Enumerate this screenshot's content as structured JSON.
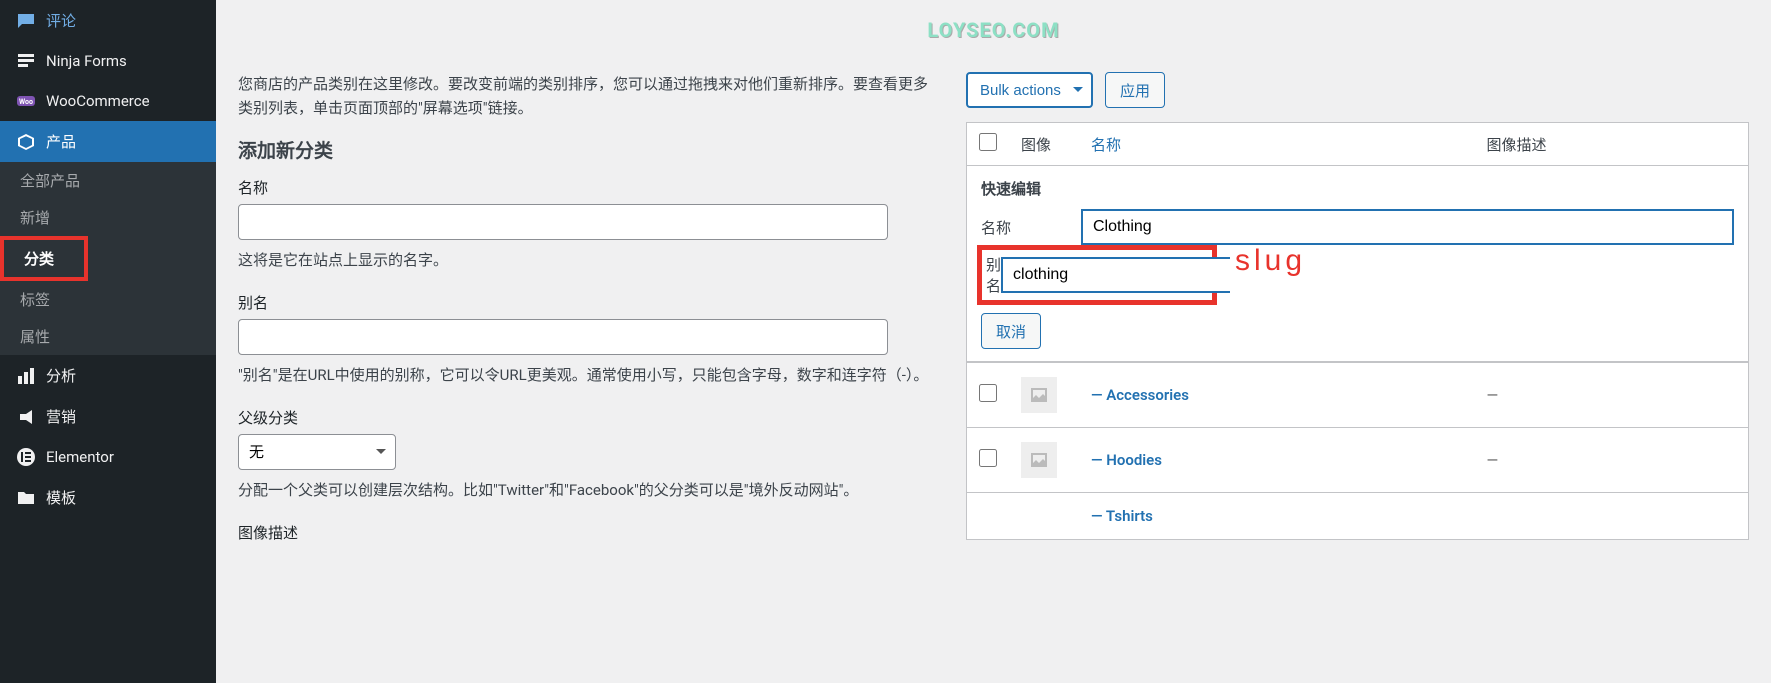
{
  "watermark": "LOYSEO.COM",
  "sidebar": {
    "items": [
      {
        "label": "评论",
        "icon": "comment"
      },
      {
        "label": "Ninja Forms",
        "icon": "form"
      },
      {
        "label": "WooCommerce",
        "icon": "woo"
      },
      {
        "label": "产品",
        "icon": "product",
        "active": true
      },
      {
        "label": "分析",
        "icon": "chart"
      },
      {
        "label": "营销",
        "icon": "megaphone"
      },
      {
        "label": "Elementor",
        "icon": "elementor"
      },
      {
        "label": "模板",
        "icon": "folder"
      }
    ],
    "submenu": [
      {
        "label": "全部产品"
      },
      {
        "label": "新增"
      },
      {
        "label": "分类",
        "current": true
      },
      {
        "label": "标签"
      },
      {
        "label": "属性"
      }
    ]
  },
  "main": {
    "intro": "您商店的产品类别在这里修改。要改变前端的类别排序，您可以通过拖拽来对他们重新排序。要查看更多类别列表，单击页面顶部的\"屏幕选项\"链接。",
    "addNewTitle": "添加新分类",
    "fields": {
      "name": {
        "label": "名称",
        "help": "这将是它在站点上显示的名字。"
      },
      "slug": {
        "label": "别名",
        "help": "\"别名\"是在URL中使用的别称，它可以令URL更美观。通常使用小写，只能包含字母，数字和连字符（-）。"
      },
      "parent": {
        "label": "父级分类",
        "selected": "无",
        "help": "分配一个父类可以创建层次结构。比如\"Twitter\"和\"Facebook\"的父分类可以是\"境外反动网站\"。"
      },
      "imageDesc": {
        "label": "图像描述"
      }
    }
  },
  "table": {
    "bulkLabel": "Bulk actions",
    "applyLabel": "应用",
    "headers": {
      "image": "图像",
      "name": "名称",
      "imageDesc": "图像描述"
    },
    "quickEdit": {
      "title": "快速编辑",
      "nameLabel": "名称",
      "nameValue": "Clothing",
      "slugLabel": "别名",
      "slugValue": "clothing",
      "cancelLabel": "取消"
    },
    "annotation": "slug",
    "rows": [
      {
        "name": "— Accessories",
        "desc": "—"
      },
      {
        "name": "— Hoodies",
        "desc": "—"
      },
      {
        "name": "— Tshirts"
      }
    ]
  }
}
